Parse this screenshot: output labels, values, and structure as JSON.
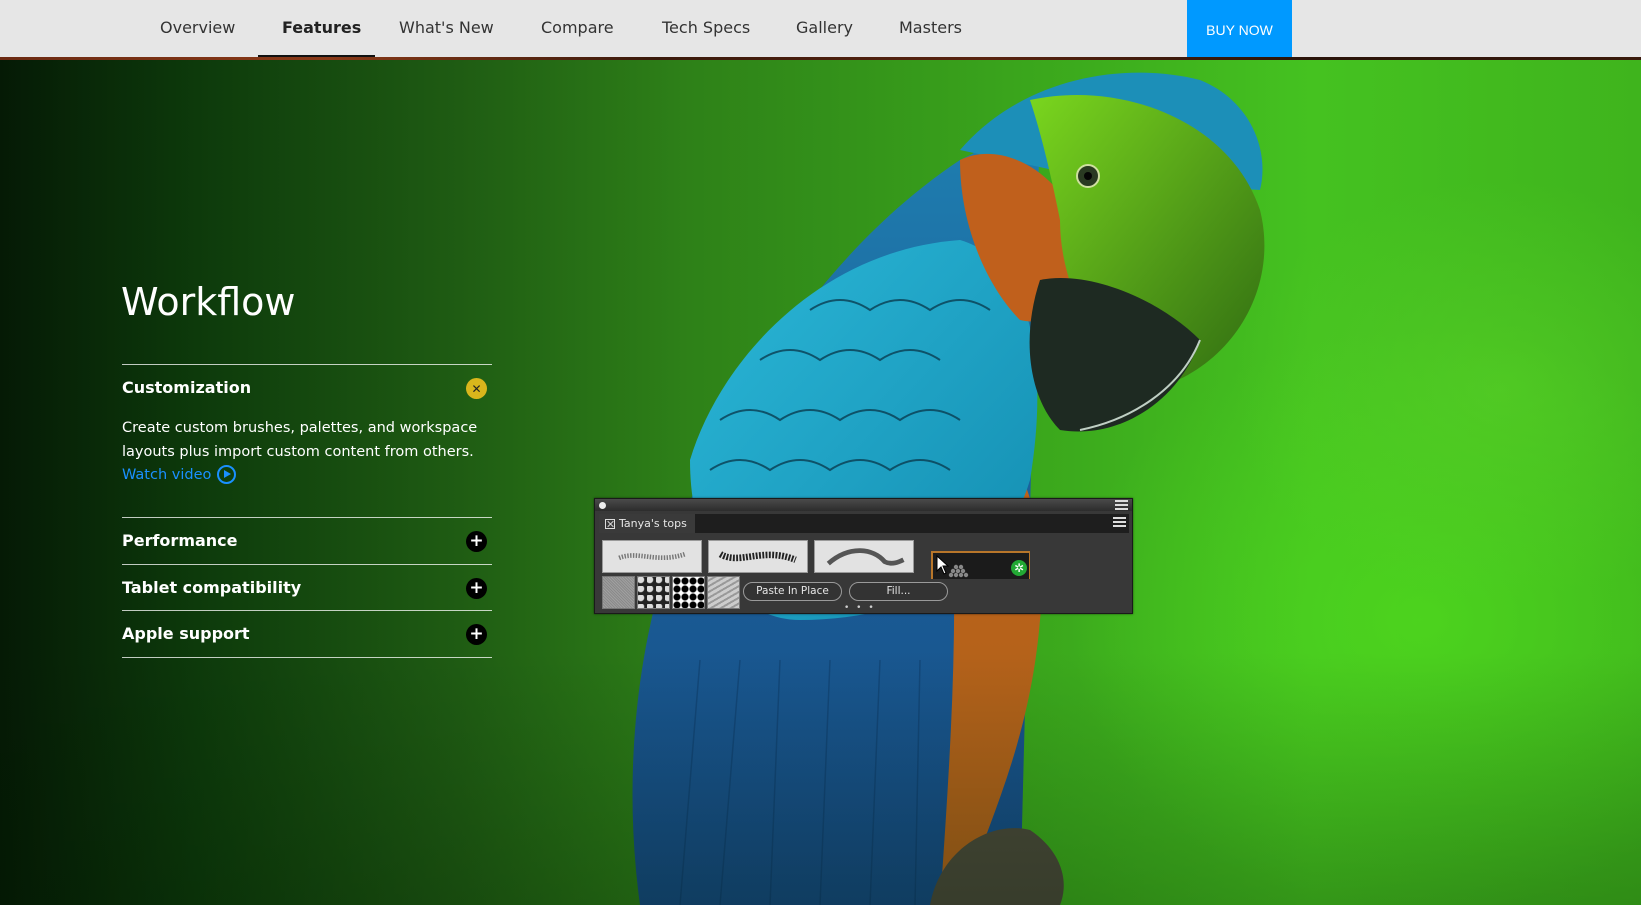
{
  "nav": {
    "items": [
      {
        "label": "Overview",
        "active": false
      },
      {
        "label": "Features",
        "active": true
      },
      {
        "label": "What's New",
        "active": false
      },
      {
        "label": "Compare",
        "active": false
      },
      {
        "label": "Tech Specs",
        "active": false
      },
      {
        "label": "Gallery",
        "active": false
      },
      {
        "label": "Masters",
        "active": false
      }
    ],
    "buy_label": "BUY NOW"
  },
  "section": {
    "title": "Workflow",
    "accordion": [
      {
        "title": "Customization",
        "expanded": true,
        "icon": "close-icon",
        "description": "Create custom brushes, palettes, and workspace layouts plus import custom content from others.",
        "link_label": "Watch video"
      },
      {
        "title": "Performance",
        "expanded": false,
        "icon": "plus-icon"
      },
      {
        "title": "Tablet compatibility",
        "expanded": false,
        "icon": "plus-icon"
      },
      {
        "title": "Apple support",
        "expanded": false,
        "icon": "plus-icon"
      }
    ]
  },
  "panel": {
    "tab_label": "Tanya's tops",
    "buttons": [
      "Paste In Place",
      "Fill..."
    ],
    "more": "• • •"
  },
  "colors": {
    "accent_blue": "#0099ff",
    "link_blue": "#1a90ff",
    "close_badge": "#d9b61c",
    "nav_bg": "#e6e6e6"
  }
}
